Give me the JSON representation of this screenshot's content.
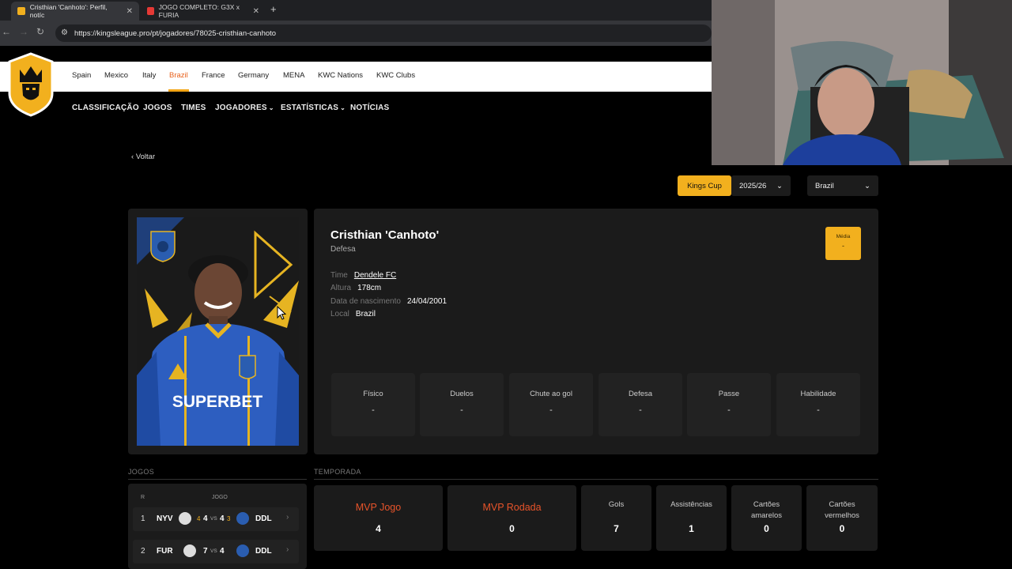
{
  "browser": {
    "tabs": [
      {
        "title": "Cristhian 'Canhoto': Perfil, notíc",
        "active": true
      },
      {
        "title": "JOGO COMPLETO: G3X x FURIA",
        "active": false
      }
    ],
    "url": "https://kingsleague.pro/pt/jogadores/78025-cristhian-canhoto"
  },
  "countries": [
    {
      "label": "Spain",
      "active": false
    },
    {
      "label": "Mexico",
      "active": false
    },
    {
      "label": "Italy",
      "active": false
    },
    {
      "label": "Brazil",
      "active": true
    },
    {
      "label": "France",
      "active": false
    },
    {
      "label": "Germany",
      "active": false
    },
    {
      "label": "MENA",
      "active": false
    },
    {
      "label": "KWC Nations",
      "active": false
    },
    {
      "label": "KWC Clubs",
      "active": false
    }
  ],
  "nav": [
    "CLASSIFICAÇÃO",
    "JOGOS",
    "TIMES",
    "JOGADORES",
    "ESTATÍSTICAS",
    "NOTÍCIAS"
  ],
  "back_label": "Voltar",
  "filters": {
    "competition": "Kings Cup",
    "season": "2025/26",
    "country": "Brazil"
  },
  "player": {
    "name": "Cristhian 'Canhoto'",
    "position": "Defesa",
    "media_label": "Média",
    "media_value": "-",
    "details": [
      {
        "label": "Time",
        "value": "Dendele FC"
      },
      {
        "label": "Altura",
        "value": "178cm"
      },
      {
        "label": "Data de nascimento",
        "value": "24/04/2001"
      },
      {
        "label": "Local",
        "value": "Brazil"
      }
    ],
    "shirt_text": "SUPERBET"
  },
  "attributes": [
    {
      "label": "Físico",
      "value": "-"
    },
    {
      "label": "Duelos",
      "value": "-"
    },
    {
      "label": "Chute ao gol",
      "value": "-"
    },
    {
      "label": "Defesa",
      "value": "-"
    },
    {
      "label": "Passe",
      "value": "-"
    },
    {
      "label": "Habilidade",
      "value": "-"
    }
  ],
  "games": {
    "section_label": "JOGOS",
    "col_round": "R",
    "col_game": "JOGO",
    "rows": [
      {
        "round": "1",
        "home": "NYV",
        "score_home": "4",
        "pen_home": "4",
        "vs": "VS",
        "score_away": "4",
        "pen_away": "3",
        "away": "DDL"
      },
      {
        "round": "2",
        "home": "FUR",
        "score_home": "7",
        "pen_home": "",
        "vs": "VS",
        "score_away": "4",
        "pen_away": "",
        "away": "DDL"
      }
    ]
  },
  "season": {
    "section_label": "TEMPORADA",
    "stats": [
      {
        "label": "MVP Jogo",
        "value": "4"
      },
      {
        "label": "MVP Rodada",
        "value": "0"
      },
      {
        "label": "Gols",
        "value": "7"
      },
      {
        "label": "Assistências",
        "value": "1"
      },
      {
        "label": "Cartões amarelos",
        "value": "0"
      },
      {
        "label": "Cartões vermelhos",
        "value": "0"
      }
    ]
  },
  "colors": {
    "accent": "#f2b01e",
    "active_country": "#e8611b",
    "mvp_red": "#e8542a"
  }
}
